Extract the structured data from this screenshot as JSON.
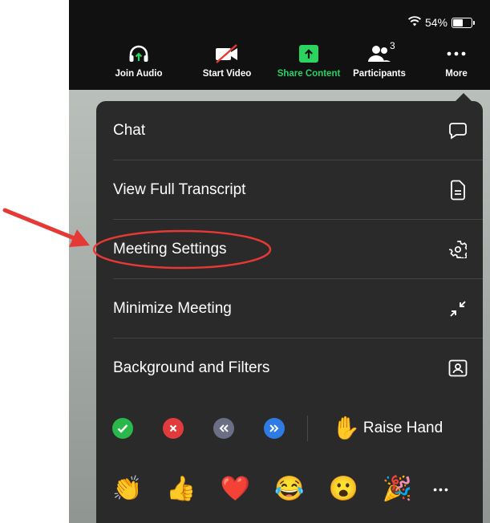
{
  "status": {
    "battery": "54%"
  },
  "toolbar": {
    "join_audio": "Join Audio",
    "start_video": "Start Video",
    "share_content": "Share Content",
    "participants": "Participants",
    "participants_count": "3",
    "more": "More"
  },
  "menu": {
    "items": [
      {
        "label": "Chat",
        "icon": "chat-bubble-icon"
      },
      {
        "label": "View Full Transcript",
        "icon": "document-icon"
      },
      {
        "label": "Meeting Settings",
        "icon": "gear-icon"
      },
      {
        "label": "Minimize Meeting",
        "icon": "minimize-arrows-icon"
      },
      {
        "label": "Background and Filters",
        "icon": "portrait-frame-icon"
      }
    ],
    "raise_hand": "Raise Hand",
    "emoji_row": [
      "👏",
      "👍",
      "❤️",
      "😂",
      "😮",
      "🎉"
    ],
    "more_dots": "•••"
  },
  "annotation": {
    "highlight_color": "#e53935"
  },
  "colors": {
    "share_green": "#2bd45f",
    "menu_bg": "#2a2a2a",
    "toolbar_bg": "#111111"
  }
}
